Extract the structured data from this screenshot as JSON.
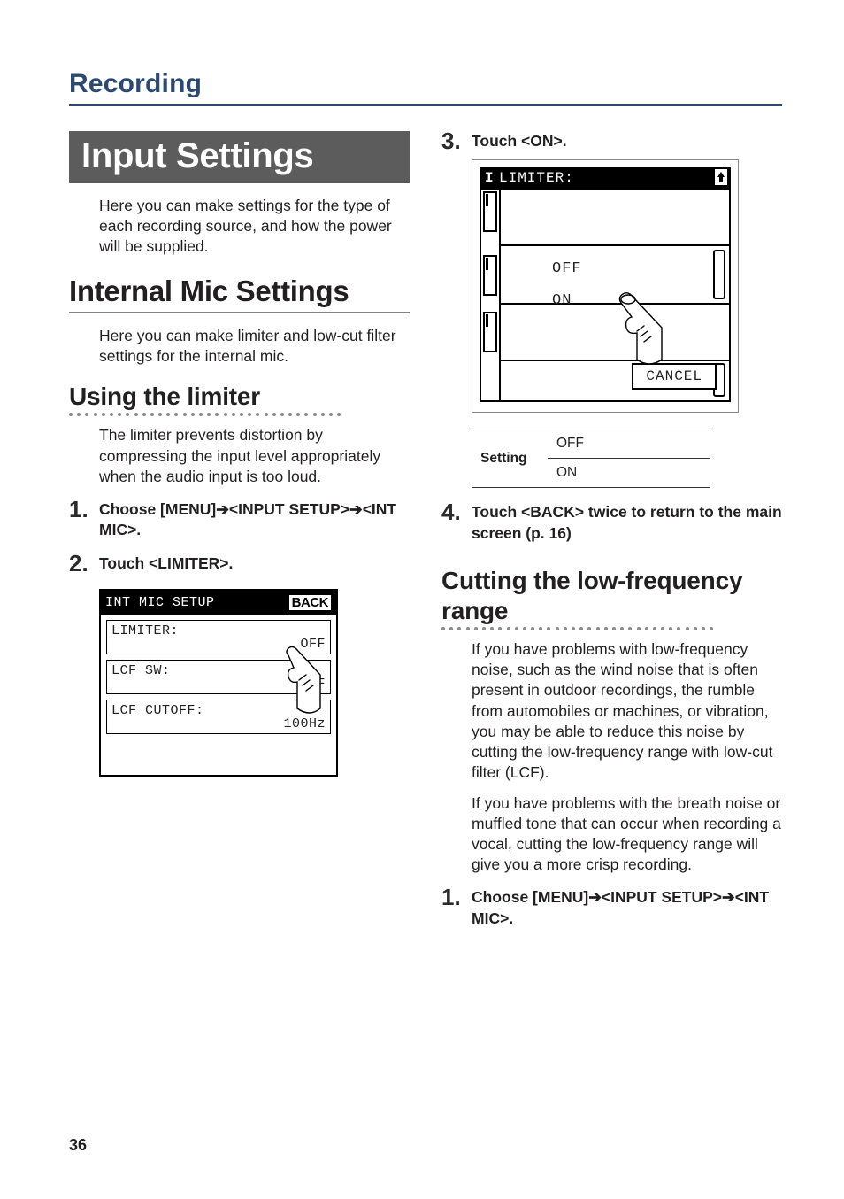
{
  "breadcrumb": "Recording",
  "page_number": "36",
  "left": {
    "h1": "Input Settings",
    "intro": "Here you can make settings for the type of each recording source, and how the power will be supplied.",
    "h2": "Internal Mic Settings",
    "h2_body": "Here you can make limiter and low-cut filter settings for the internal mic.",
    "h3": "Using the limiter",
    "h3_body": "The limiter prevents distortion by compressing the input level appropriately when the audio input is too loud.",
    "step1": "Choose [MENU]➔<INPUT SETUP>➔<INT MIC>.",
    "step2": "Touch <LIMITER>.",
    "fig1": {
      "title": "INT MIC SETUP",
      "back": "BACK",
      "rows": [
        {
          "label": "LIMITER:",
          "value": "OFF"
        },
        {
          "label": "LCF SW:",
          "value": "OFF"
        },
        {
          "label": "LCF CUTOFF:",
          "value": "100Hz"
        }
      ]
    }
  },
  "right": {
    "step3": "Touch <ON>.",
    "fig2": {
      "title": "LIMITER:",
      "off": "OFF",
      "on": "ON",
      "cancel": "CANCEL"
    },
    "table": {
      "label": "Setting",
      "v1": "OFF",
      "v2": "ON"
    },
    "step4": "Touch <BACK> twice to return to the main screen (p. 16)",
    "h3b_line1": "Cutting the low-frequency",
    "h3b_line2": "range",
    "h3b_body1": "If you have problems with low-frequency noise, such as the wind noise that is often present in outdoor recordings, the rumble from automobiles or machines, or vibration, you may be able to reduce this noise by cutting the low-frequency range with low-cut filter (LCF).",
    "h3b_body2": "If you have problems with the breath noise or muffled tone that can occur when recording a vocal, cutting the low-frequency range will give you a more crisp recording.",
    "step1b": "Choose [MENU]➔<INPUT SETUP>➔<INT MIC>."
  }
}
